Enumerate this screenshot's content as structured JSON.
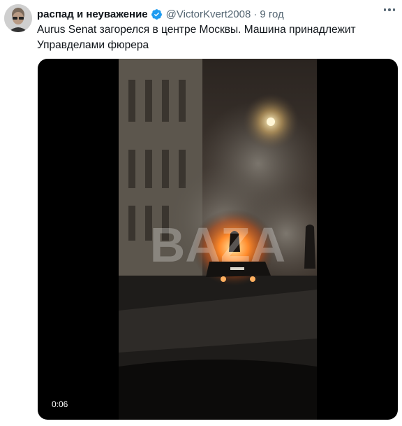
{
  "tweet": {
    "author": {
      "display_name": "распад и неуважение",
      "handle": "@VictorKvert2008",
      "avatar_icon": "person-avatar",
      "verified_icon": "verified-badge-icon",
      "verified_color": "#1d9bf0"
    },
    "separator": "·",
    "time": "9 год",
    "text": "Aurus Senat загорелся в центре Москвы. Машина принадлежит Управделами фюрера",
    "media": {
      "type": "video",
      "duration": "0:06",
      "watermark": "BAZA"
    },
    "more_icon": "more-options-icon"
  }
}
